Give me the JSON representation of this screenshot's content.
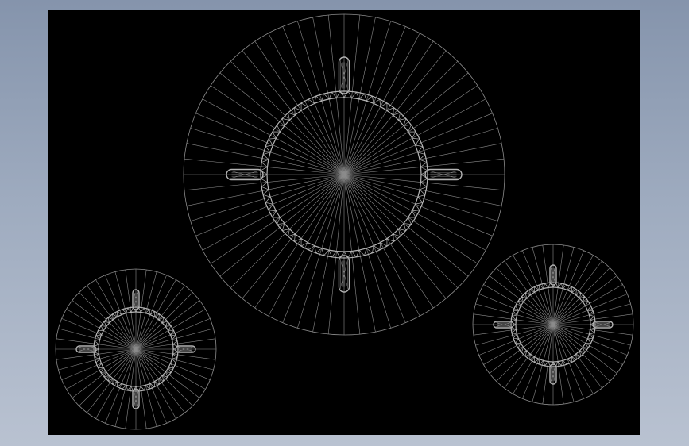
{
  "window": {
    "title": ""
  },
  "scene": {
    "background_color": "#000000",
    "wire_color": "#8c8c8c",
    "part_color": "#b4b4b4",
    "objects": [
      {
        "name": "large-wheel",
        "spokes": 64,
        "handles": 4
      },
      {
        "name": "small-wheel-left",
        "spokes": 48,
        "handles": 4
      },
      {
        "name": "small-wheel-right",
        "spokes": 48,
        "handles": 4
      }
    ]
  }
}
